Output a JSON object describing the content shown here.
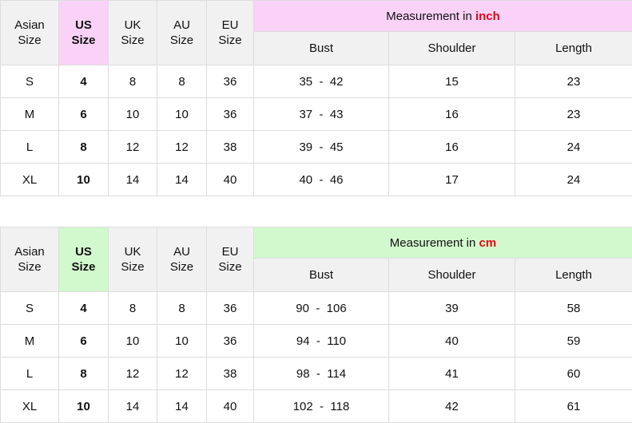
{
  "tables": [
    {
      "id": "inch-table",
      "accent_color": "#fad2f8",
      "unit_color": "#e30613",
      "banner": {
        "prefix": "Measurement in ",
        "unit": "inch"
      },
      "size_headers": [
        {
          "line1": "Asian",
          "line2": "Size",
          "key": "asian"
        },
        {
          "line1": "US",
          "line2": "Size",
          "key": "us",
          "highlight": true
        },
        {
          "line1": "UK",
          "line2": "Size",
          "key": "uk"
        },
        {
          "line1": "AU",
          "line2": "Size",
          "key": "au"
        },
        {
          "line1": "EU",
          "line2": "Size",
          "key": "eu"
        }
      ],
      "measurement_headers": [
        "Bust",
        "Shoulder",
        "Length"
      ],
      "rows": [
        {
          "asian": "S",
          "us": "4",
          "uk": "8",
          "au": "8",
          "eu": "36",
          "bust": "35  -  42",
          "shoulder": "15",
          "length": "23"
        },
        {
          "asian": "M",
          "us": "6",
          "uk": "10",
          "au": "10",
          "eu": "36",
          "bust": "37  -  43",
          "shoulder": "16",
          "length": "23"
        },
        {
          "asian": "L",
          "us": "8",
          "uk": "12",
          "au": "12",
          "eu": "38",
          "bust": "39  -  45",
          "shoulder": "16",
          "length": "24"
        },
        {
          "asian": "XL",
          "us": "10",
          "uk": "14",
          "au": "14",
          "eu": "40",
          "bust": "40  -  46",
          "shoulder": "17",
          "length": "24"
        }
      ]
    },
    {
      "id": "cm-table",
      "accent_color": "#d2f8cd",
      "unit_color": "#e30613",
      "banner": {
        "prefix": "Measurement in ",
        "unit": "cm"
      },
      "size_headers": [
        {
          "line1": "Asian",
          "line2": "Size",
          "key": "asian"
        },
        {
          "line1": "US",
          "line2": "Size",
          "key": "us",
          "highlight": true
        },
        {
          "line1": "UK",
          "line2": "Size",
          "key": "uk"
        },
        {
          "line1": "AU",
          "line2": "Size",
          "key": "au"
        },
        {
          "line1": "EU",
          "line2": "Size",
          "key": "eu"
        }
      ],
      "measurement_headers": [
        "Bust",
        "Shoulder",
        "Length"
      ],
      "rows": [
        {
          "asian": "S",
          "us": "4",
          "uk": "8",
          "au": "8",
          "eu": "36",
          "bust": "90  -  106",
          "shoulder": "39",
          "length": "58"
        },
        {
          "asian": "M",
          "us": "6",
          "uk": "10",
          "au": "10",
          "eu": "36",
          "bust": "94  -  110",
          "shoulder": "40",
          "length": "59"
        },
        {
          "asian": "L",
          "us": "8",
          "uk": "12",
          "au": "12",
          "eu": "38",
          "bust": "98  -  114",
          "shoulder": "41",
          "length": "60"
        },
        {
          "asian": "XL",
          "us": "10",
          "uk": "14",
          "au": "14",
          "eu": "40",
          "bust": "102  -  118",
          "shoulder": "42",
          "length": "61"
        }
      ]
    }
  ]
}
